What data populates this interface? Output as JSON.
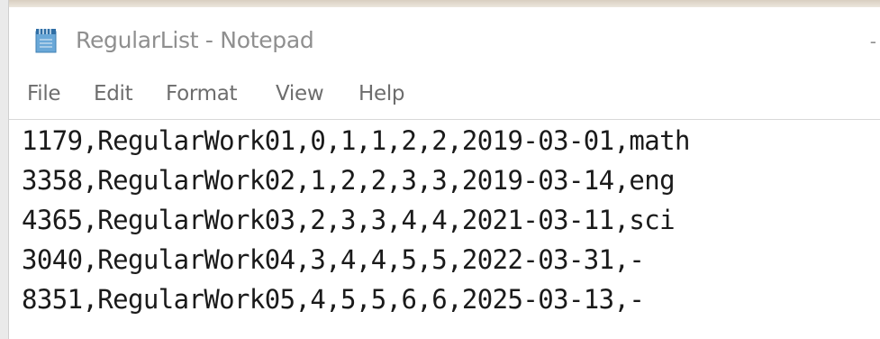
{
  "window": {
    "title": "RegularList - Notepad",
    "title_right_glyph": "-",
    "icon": "notepad-icon"
  },
  "menu": {
    "items": [
      {
        "label": "File"
      },
      {
        "label": "Edit"
      },
      {
        "label": "Format"
      },
      {
        "label": "View"
      },
      {
        "label": "Help"
      }
    ]
  },
  "editor": {
    "lines": [
      "1179,RegularWork01,0,1,1,2,2,2019-03-01,math",
      "3358,RegularWork02,1,2,2,3,3,2019-03-14,eng",
      "4365,RegularWork03,2,3,3,4,4,2021-03-11,sci",
      "3040,RegularWork04,3,4,4,5,5,2022-03-31,-",
      "8351,RegularWork05,4,5,5,6,6,2025-03-13,-"
    ]
  },
  "colors": {
    "title_text": "#8f8f8f",
    "menu_text": "#6d6d6d",
    "editor_text": "#1a1a1a",
    "background": "#ffffff"
  }
}
